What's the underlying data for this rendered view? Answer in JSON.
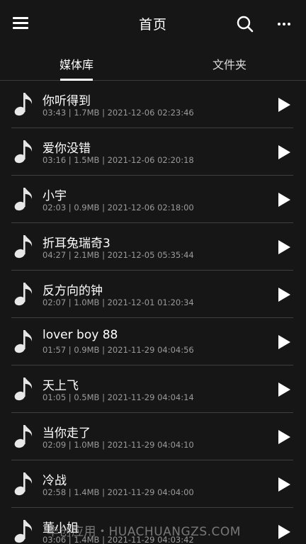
{
  "header": {
    "title": "首页",
    "menu_icon": "hamburger-menu-icon",
    "search_icon": "search-icon",
    "more_icon": "more-horizontal-icon"
  },
  "tabs": [
    {
      "label": "媒体库",
      "active": true
    },
    {
      "label": "文件夹",
      "active": false
    }
  ],
  "songs": [
    {
      "title": "你听得到",
      "meta": "03:43 | 1.7MB | 2021-12-06 02:23:46"
    },
    {
      "title": "爱你没错",
      "meta": "03:16 | 1.5MB | 2021-12-06 02:20:18"
    },
    {
      "title": "小宇",
      "meta": "02:03 | 0.9MB | 2021-12-06 02:18:00"
    },
    {
      "title": "折耳兔瑞奇3",
      "meta": "04:27 | 2.1MB | 2021-12-05 05:35:44"
    },
    {
      "title": "反方向的钟",
      "meta": "02:07 | 1.0MB | 2021-12-01 01:20:34"
    },
    {
      "title": "lover boy 88",
      "meta": "01:57 | 0.9MB | 2021-11-29 04:04:56"
    },
    {
      "title": "天上飞",
      "meta": "01:05 | 0.5MB | 2021-11-29 04:04:14"
    },
    {
      "title": "当你走了",
      "meta": "02:09 | 1.0MB | 2021-11-29 04:04:10"
    },
    {
      "title": "冷战",
      "meta": "02:58 | 1.4MB | 2021-11-29 04:04:00"
    },
    {
      "title": "董小姐",
      "meta": "03:06 | 1.4MB | 2021-11-29 04:03:42"
    }
  ],
  "watermark": "华创应用・HUACHUANGZS.COM",
  "colors": {
    "background": "#161616",
    "text_primary": "#ffffff",
    "text_secondary": "#9a9a9a",
    "divider": "#3f3f3f"
  }
}
